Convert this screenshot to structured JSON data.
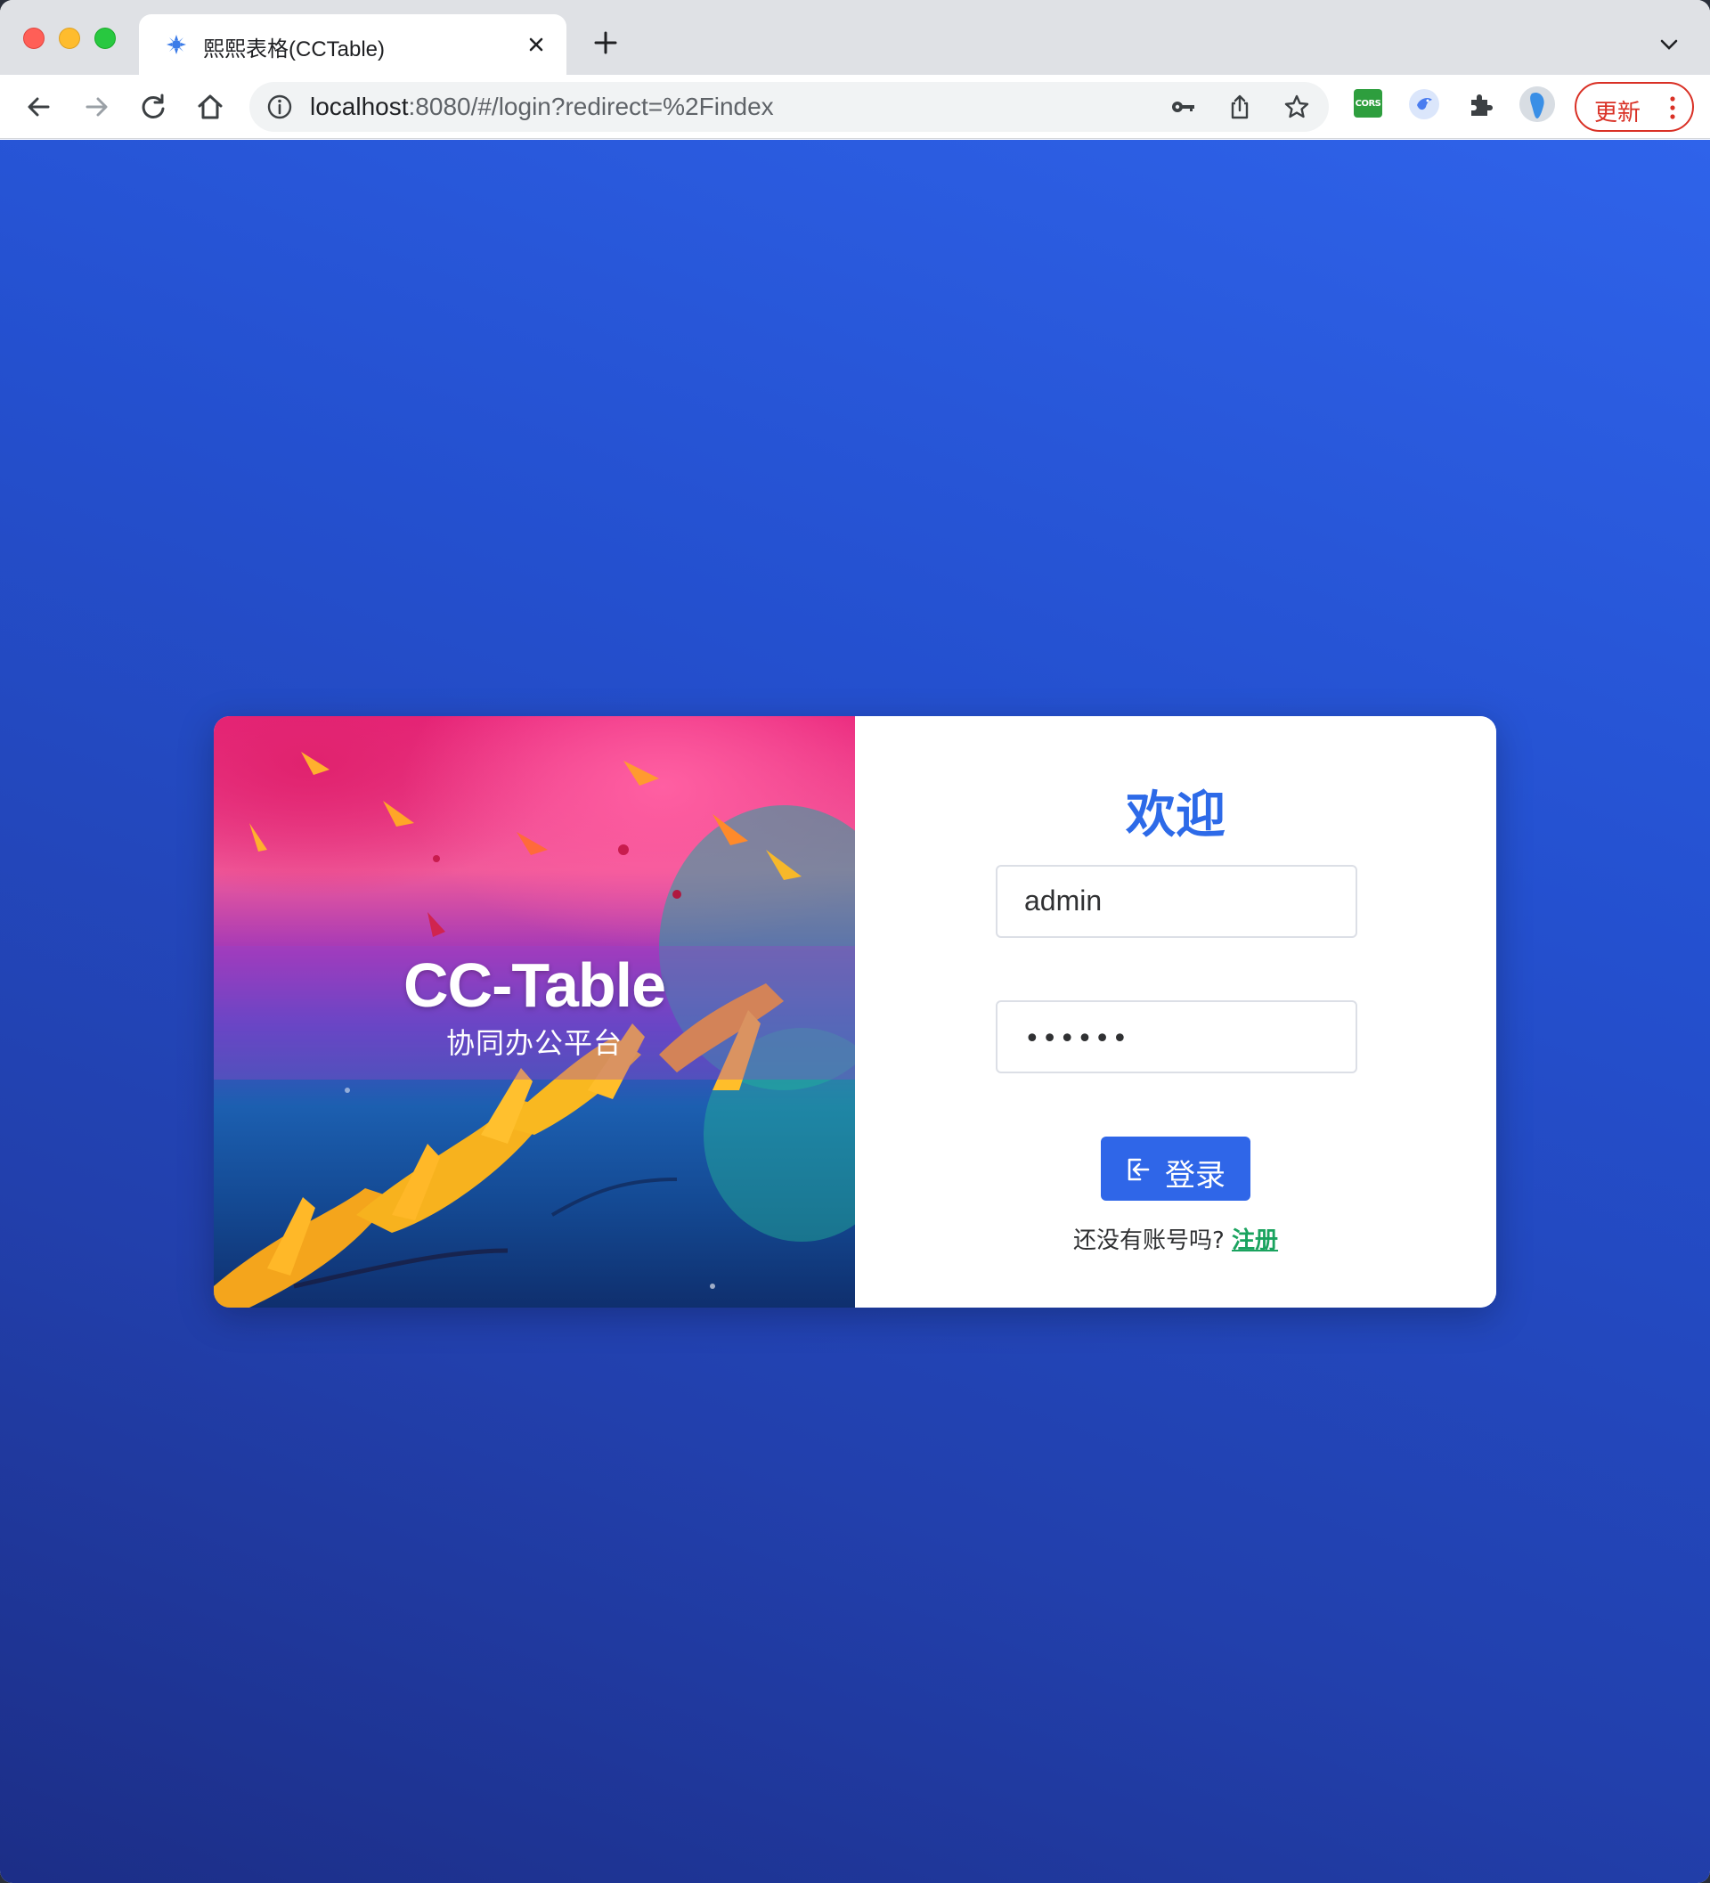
{
  "browser": {
    "tab_title": "熙熙表格(CCTable)",
    "url_host": "localhost",
    "url_rest": ":8080/#/login?redirect=%2Findex",
    "extension_cors_label": "CORS",
    "update_label": "更新",
    "icons": [
      "close-icon",
      "new-tab-icon",
      "chevron-down-icon",
      "back-icon",
      "forward-icon",
      "reload-icon",
      "home-icon",
      "info-icon",
      "key-icon",
      "share-icon",
      "star-icon",
      "puzzle-icon",
      "kebab-menu-icon"
    ]
  },
  "brand": {
    "title": "CC-Table",
    "subtitle": "协同办公平台"
  },
  "login": {
    "welcome": "欢迎",
    "username_value": "admin",
    "password_mask": "••••••",
    "login_label": "登录",
    "register_prompt": "还没有账号吗?",
    "register_link": "注册"
  },
  "colors": {
    "accent": "#2f66e8",
    "welcome": "#2d6ae8",
    "register_link": "#1aa35f",
    "background_top": "#2f63ea",
    "background_bottom": "#1c2e87",
    "update_red": "#d93025"
  }
}
